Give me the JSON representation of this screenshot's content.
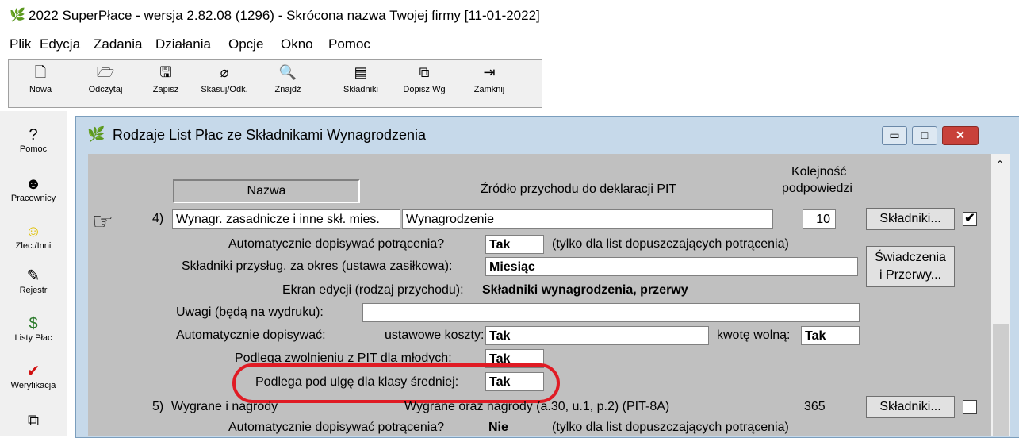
{
  "app": {
    "title": "2022 SuperPłace - wersja 2.82.08 (1296) - Skrócona nazwa Twojej firmy [11-01-2022]"
  },
  "menu": [
    "Plik",
    "Edycja",
    "Zadania",
    "Działania",
    "Opcje",
    "Okno",
    "Pomoc"
  ],
  "toolbar": [
    {
      "icon": "new-doc-icon",
      "glyph": "🗋",
      "label": "Nowa"
    },
    {
      "icon": "open-folder-icon",
      "glyph": "🗁",
      "label": "Odczytaj"
    },
    {
      "icon": "save-icon",
      "glyph": "🖫",
      "label": "Zapisz"
    },
    {
      "icon": "eraser-icon",
      "glyph": "⌀",
      "label": "Skasuj/Odk."
    },
    {
      "icon": "find-icon",
      "glyph": "🔍",
      "label": "Znajdź"
    },
    {
      "icon": "components-icon",
      "glyph": "▤",
      "label": "Składniki"
    },
    {
      "icon": "copy-icon",
      "glyph": "⧉",
      "label": "Dopisz Wg"
    },
    {
      "icon": "exit-icon",
      "glyph": "⇥",
      "label": "Zamknij"
    }
  ],
  "sidebar": [
    {
      "icon": "help-icon",
      "glyph": "?",
      "label": "Pomoc"
    },
    {
      "icon": "employees-icon",
      "glyph": "☻",
      "label": "Pracownicy"
    },
    {
      "icon": "smiley-icon",
      "glyph": "☺",
      "label": "Zlec./Inni"
    },
    {
      "icon": "register-icon",
      "glyph": "✎",
      "label": "Rejestr"
    },
    {
      "icon": "payroll-icon",
      "glyph": "$",
      "label": "Listy Płac"
    },
    {
      "icon": "check-icon",
      "glyph": "✔",
      "label": "Weryfikacja"
    },
    {
      "icon": "copy-icon",
      "glyph": "⧉",
      "label": ""
    }
  ],
  "window": {
    "title": "Rodzaje List Płac ze Składnikami Wynagrodzenia",
    "controls": {
      "minimize": "▭",
      "maximize": "□",
      "close": "✕"
    },
    "headers": {
      "name": "Nazwa",
      "source": "Źródło przychodu do deklaracji PIT",
      "order_line1": "Kolejność",
      "order_line2": "podpowiedzi"
    },
    "row4": {
      "number": "4)",
      "name": "Wynagr. zasadnicze i inne skł. mies.",
      "source": "Wynagrodzenie",
      "order": "10",
      "btn_components": "Składniki...",
      "checked_glyph": "✔",
      "auto_deductions_label": "Automatycznie dopisywać potrącenia?",
      "auto_deductions_value": "Tak",
      "auto_deductions_note": "(tylko dla list dopuszczających potrącenia)",
      "period_label": "Składniki przysług. za okres (ustawa zasiłkowa):",
      "period_value": "Miesiąc",
      "btn_benefits_line1": "Świadczenia",
      "btn_benefits_line2": "i Przerwy...",
      "screen_label": "Ekran edycji (rodzaj przychodu):",
      "screen_value": "Składniki wynagrodzenia, przerwy",
      "notes_label": "Uwagi (będą na wydruku):",
      "notes_value": "",
      "auto_add_label": "Automatycznie dopisywać:",
      "costs_label": "ustawowe koszty:",
      "costs_value": "Tak",
      "free_amount_label": "kwotę wolną:",
      "free_amount_value": "Tak",
      "youth_label": "Podlega zwolnieniu z PIT dla młodych:",
      "youth_value": "Tak",
      "middle_class_label": "Podlega pod ulgę dla klasy średniej:",
      "middle_class_value": "Tak"
    },
    "row5": {
      "number": "5)",
      "name": "Wygrane i nagrody",
      "source": "Wygrane oraz nagrody (a.30, u.1, p.2) (PIT-8A)",
      "order": "365",
      "btn_components": "Składniki...",
      "auto_deductions_label": "Automatycznie dopisywać potrącenia?",
      "auto_deductions_value": "Nie",
      "auto_deductions_note": "(tylko dla list dopuszczających potrącenia)"
    },
    "pointer_glyph": "☞"
  },
  "colors": {
    "highlight_oval": "#e01b24",
    "window_bg": "#c6d9ea",
    "client_bg": "#c0c0c0"
  }
}
